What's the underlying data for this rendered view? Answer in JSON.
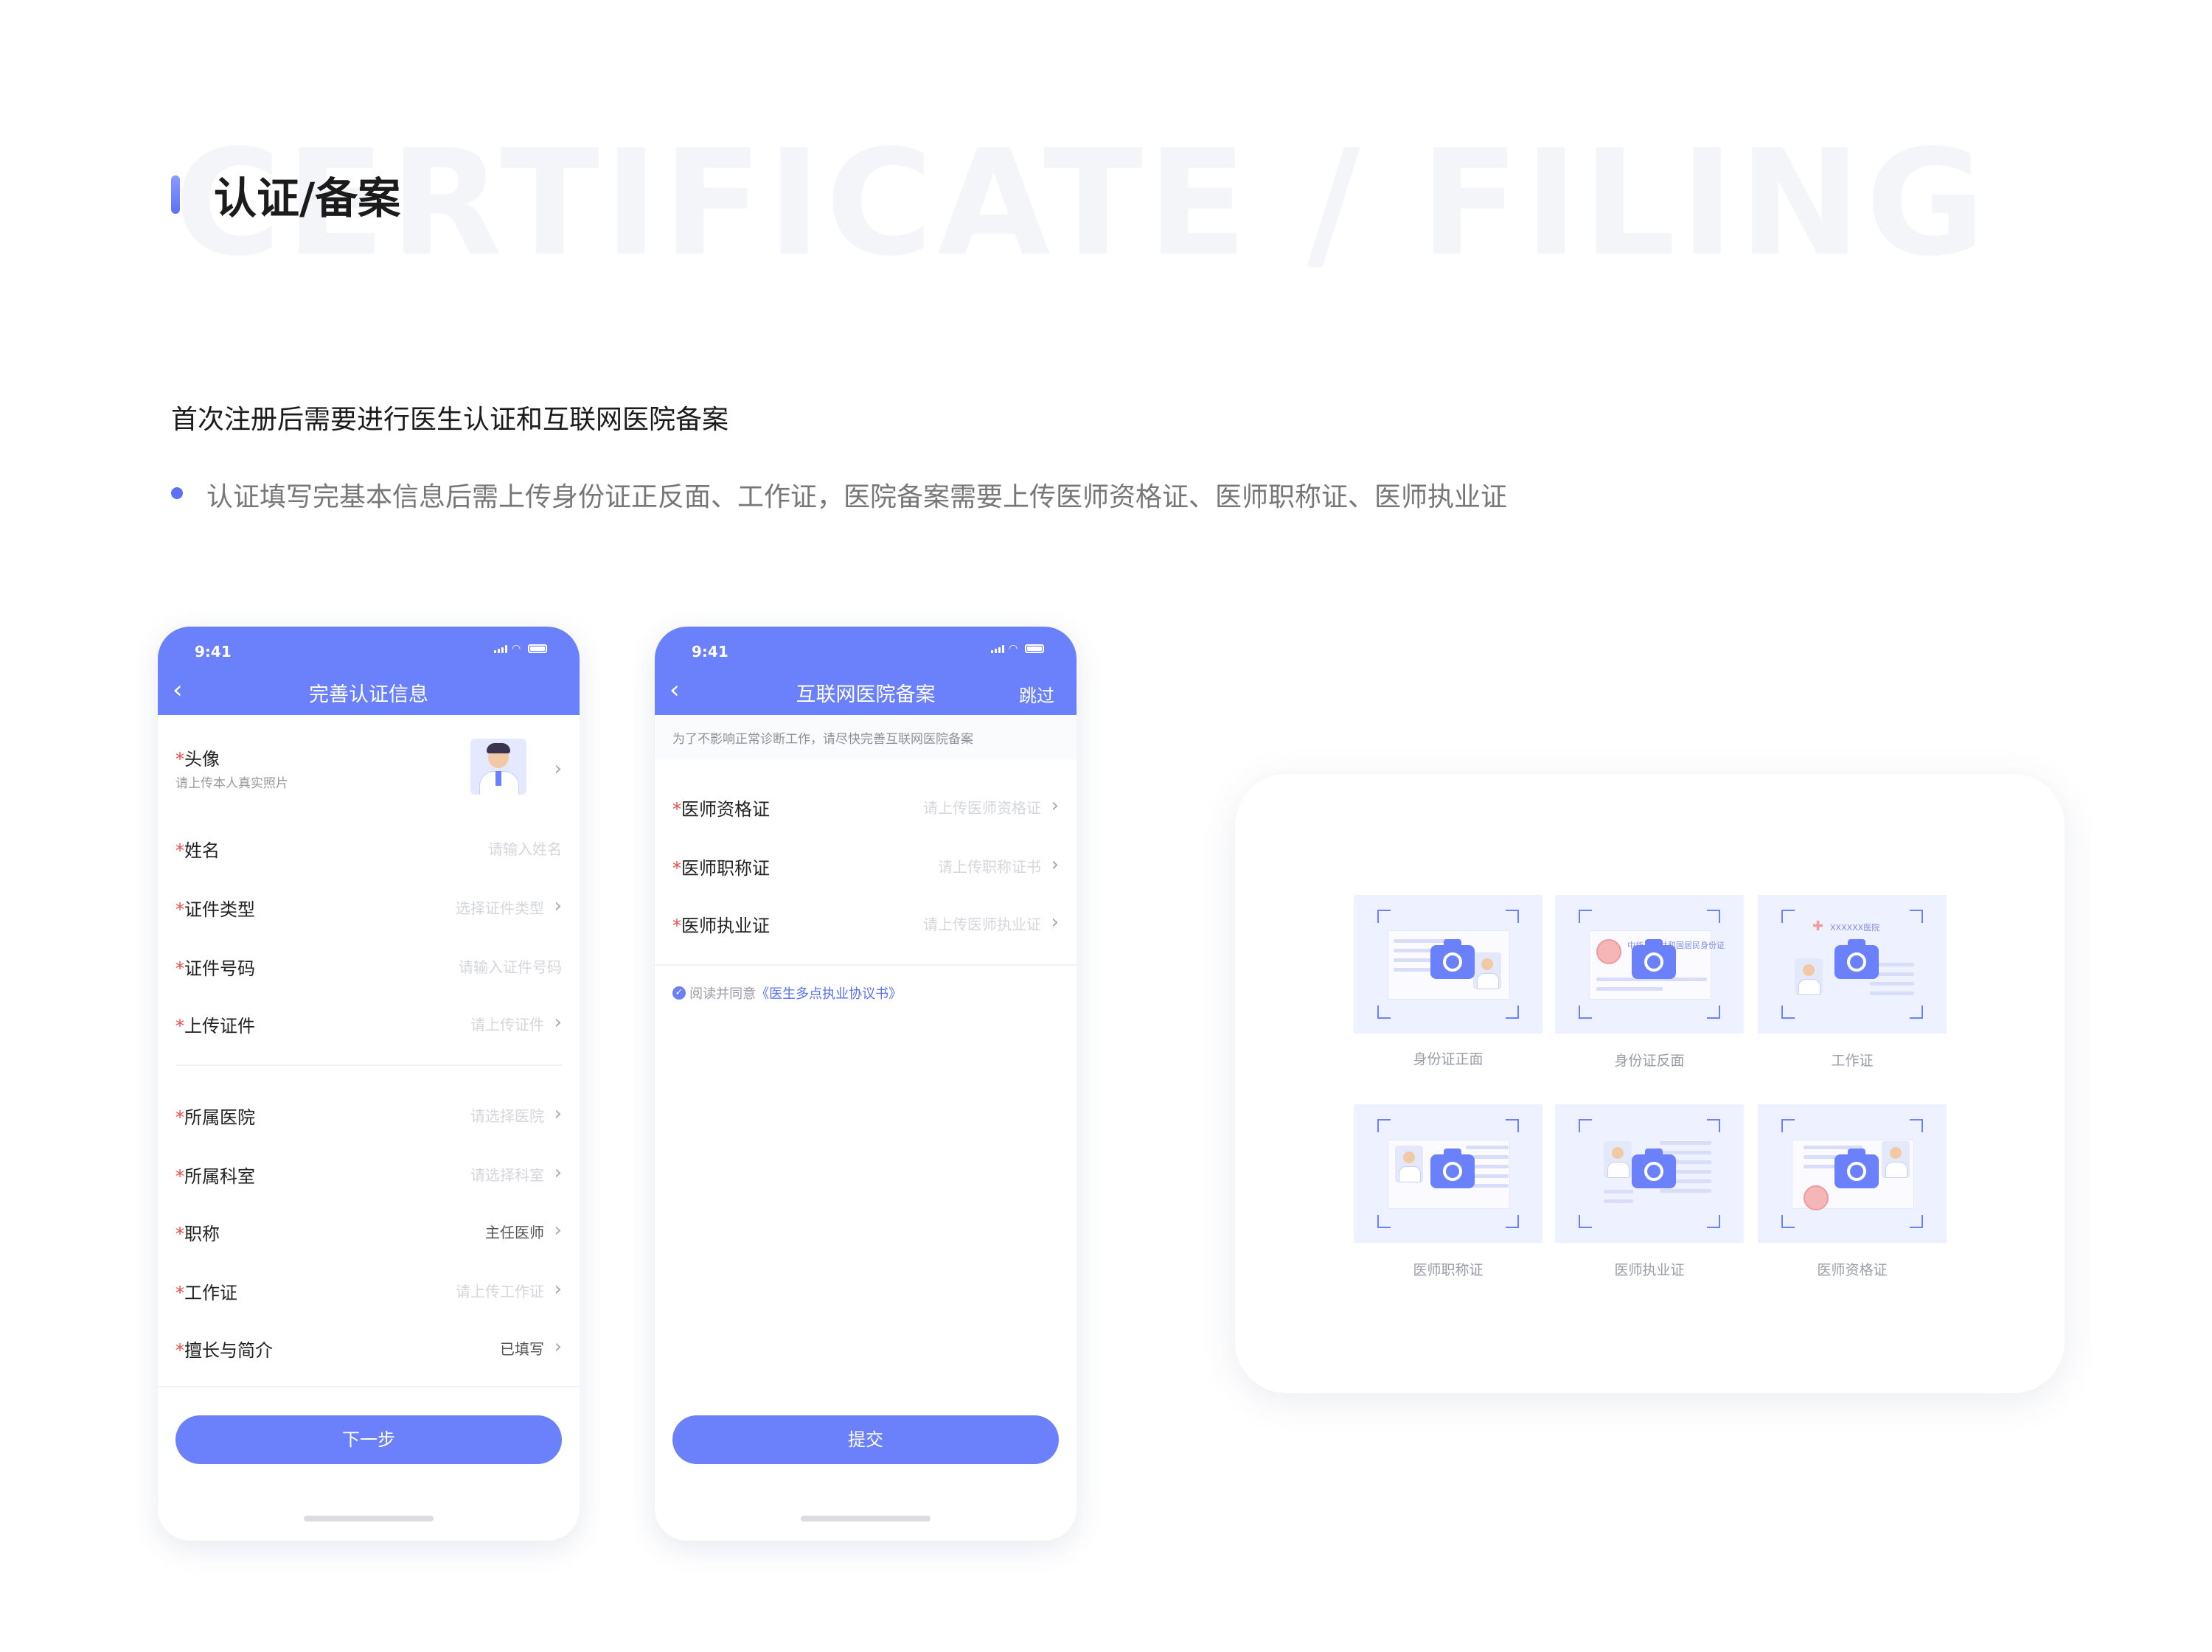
{
  "header": {
    "bg_word": "CERTIFICATE / FILING",
    "title": "认证/备案",
    "subtitle": "首次注册后需要进行医生认证和互联网医院备案",
    "bullet": "认证填写完基本信息后需上传身份证正反面、工作证，医院备案需要上传医师资格证、医师职称证、医师执业证",
    "accent": "#5b72f7"
  },
  "phone1": {
    "time": "9:41",
    "title": "完善认证信息",
    "avatar_label": "头像",
    "avatar_hint": "请上传本人真实照片",
    "rows_a": [
      {
        "label": "姓名",
        "value": ""
      },
      {
        "label": "证件类型",
        "value": "选择证件类型"
      },
      {
        "label": "证件号码",
        "value": "请输入证件号码"
      },
      {
        "label": "上传证件",
        "value": "请上传证件"
      }
    ],
    "name_placeholder": "请输入姓名",
    "rows_b": [
      {
        "label": "所属医院",
        "value": "请选择医院"
      },
      {
        "label": "所属科室",
        "value": "请选择科室"
      },
      {
        "label": "职称",
        "value": "主任医师"
      },
      {
        "label": "工作证",
        "value": "请上传工作证"
      },
      {
        "label": "擅长与简介",
        "value": "已填写"
      }
    ],
    "button": "下一步"
  },
  "phone2": {
    "time": "9:41",
    "title": "互联网医院备案",
    "skip": "跳过",
    "notice": "为了不影响正常诊断工作，请尽快完善互联网医院备案",
    "rows": [
      {
        "label": "医师资格证",
        "value": "请上传医师资格证"
      },
      {
        "label": "医师职称证",
        "value": "请上传职称证书"
      },
      {
        "label": "医师执业证",
        "value": "请上传医师执业证"
      }
    ],
    "agree_prefix": "阅读并同意",
    "agree_link": "《医生多点执业协议书》",
    "button": "提交"
  },
  "card": {
    "tiles": [
      {
        "label": "身份证正面"
      },
      {
        "label": "身份证反面",
        "text": "中华人民共和国居民身份证"
      },
      {
        "label": "工作证",
        "text": "XXXXXX医院"
      },
      {
        "label": "医师职称证"
      },
      {
        "label": "医师执业证"
      },
      {
        "label": "医师资格证"
      }
    ]
  }
}
